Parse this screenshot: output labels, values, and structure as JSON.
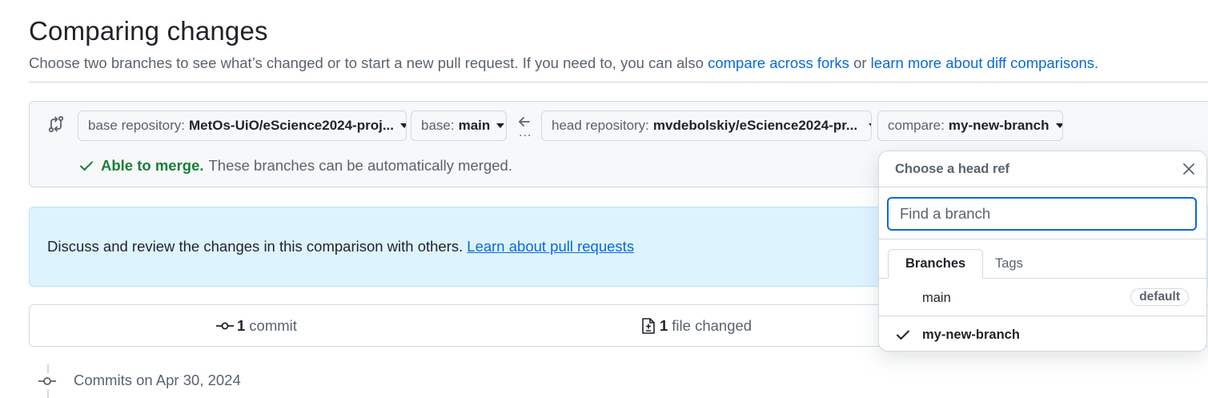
{
  "page": {
    "title": "Comparing changes",
    "subtitle_text": "Choose two branches to see what’s changed or to start a new pull request. If you need to, you can also",
    "link_forks": "compare across forks",
    "or_text": "or",
    "link_learn_diff": "learn more about diff comparisons",
    "subtitle_end": "."
  },
  "range": {
    "base_repo_label": "base repository:",
    "base_repo_value": "MetOs-UiO/eScience2024-proj...",
    "base_label": "base:",
    "base_value": "main",
    "head_repo_label": "head repository:",
    "head_repo_value": "mvdebolskiy/eScience2024-pr...",
    "compare_label": "compare:",
    "compare_value": "my-new-branch",
    "dots": "...",
    "merge_ok": "Able to merge.",
    "merge_text": "These branches can be automatically merged."
  },
  "info": {
    "text": "Discuss and review the changes in this comparison with others.",
    "link": "Learn about pull requests"
  },
  "stats": {
    "commits_count": "1",
    "commits_label": "commit",
    "files_count": "1",
    "files_label": "file changed"
  },
  "timeline": {
    "date_label": "Commits on Apr 30, 2024"
  },
  "popover": {
    "title": "Choose a head ref",
    "search_placeholder": "Find a branch",
    "tab_branches": "Branches",
    "tab_tags": "Tags",
    "items": [
      {
        "name": "main",
        "badge": "default",
        "selected": false
      },
      {
        "name": "my-new-branch",
        "badge": "",
        "selected": true
      }
    ]
  },
  "colors": {
    "link": "#0969da",
    "success": "#1a7f37",
    "info_bg": "#ddf4ff",
    "muted": "#59636e"
  }
}
